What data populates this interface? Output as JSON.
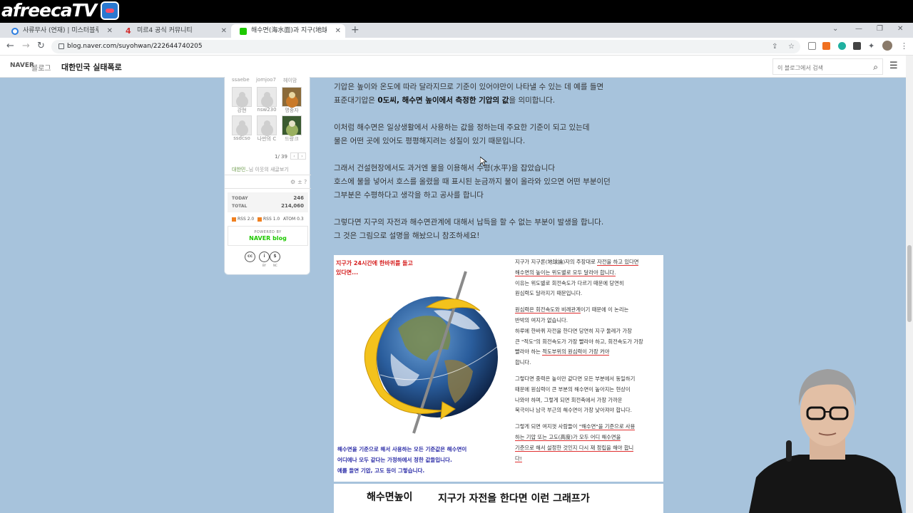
{
  "stream": {
    "logo": "afreecaTV"
  },
  "tabs": [
    {
      "label": "사류무사 (연재) | 미스터블루 - 웹",
      "icon": "chat-icon",
      "color": "#2a7de1"
    },
    {
      "label": "미르4 공식 커뮤니티",
      "icon": "mir4-icon",
      "color": "#d32f2f"
    },
    {
      "label": "해수면(海水面)과 지구(地球)의 기",
      "icon": "naver-blog-icon",
      "color": "#1ec800"
    }
  ],
  "address": {
    "url": "blog.naver.com/suyohwan/222644740205"
  },
  "blog": {
    "naver": "NAVER",
    "blog_label": "블로그",
    "title": "대한민국 실태폭로",
    "search_placeholder": "이 블로그에서 검색"
  },
  "sidebar": {
    "top_names": [
      "ssaebe",
      "jomjoo7",
      "헤이맘"
    ],
    "neighbors": [
      {
        "name": "강현"
      },
      {
        "name": "nsw230"
      },
      {
        "name": "명중자"
      },
      {
        "name": "ssdcso"
      },
      {
        "name": "나만의 C"
      },
      {
        "name": "드랑크"
      }
    ],
    "pager": "1/ 39",
    "neighbors_link": "대한민..",
    "neighbors_rest": "님 이웃의 새글보기",
    "today_label": "TODAY",
    "today_value": "246",
    "total_label": "TOTAL",
    "total_value": "214,060",
    "rss_links": [
      "RSS 2.0",
      "RSS 1.0",
      "ATOM 0.3"
    ],
    "powered_by": "POWERED BY",
    "naver_blog": "NAVER blog",
    "cc_labels": [
      "BY",
      "NC"
    ]
  },
  "article": {
    "p1_l1": "기압은 높이와 온도에 따라 달라지므로 기준이 있어야만이 나타낼 수 있는 데 예를 들면",
    "p1_l2_a": "표준대기압은 ",
    "p1_l2_b": "0도씨, 해수면 높이에서 측정한 기압의 값",
    "p1_l2_c": "을 의미합니다.",
    "p2_l1": "이처럼 해수면은 일상생활에서 사용하는 값을 정하는데 주요한 기준이 되고 있는데",
    "p2_l2": "물은 어떤 곳에 있어도 평평해지려는 성질이 있기 때문입니다.",
    "p3_l1": "그래서 건설현장에서도 과거엔 물을 이용해서 수평(水平)을 잡았습니다",
    "p3_l2": "호스에 물을 넣어서 호스를 올렸을 때 표시된 눈금까지 물이 올라와 있으면 어떤 부분이던",
    "p3_l3": "그부분은 수평하다고 생각을 하고 공사를 합니다",
    "p4_l1": "그렇다면 지구의 자전과 해수면관계에 대해서 납득을 할 수 없는 부분이 발생을 합니다.",
    "p4_l2": "그 것은 그림으로 설명을 해놨으니 참조하세요!"
  },
  "figure": {
    "title_l1": "지구가 24시간에 한바퀴를 돌고",
    "title_l2": "있다면...",
    "bottom_l1": "해수면을 기준으로 해서 사용하는 모든 기준값은 해수면이",
    "bottom_l2": "어디에나 모두 같다는 가정하에서 정한 값들입니다.",
    "bottom_l3": "예를 들면 기압, 고도 등이 그렇습니다.",
    "r1a": "지구가 지구론(地球論)자의 주장대로 ",
    "r1b": "자전을 하고 있다면",
    "r2": "해수면의 높이는 위도별로 모두 달라야 합니다.",
    "r3": "이유는 위도별로 회전속도가 다르기 때문에 당연히",
    "r4": "원심력도 달라지기 때문입니다.",
    "r5a": "원심력은 회전속도와 비례관계",
    "r5b": "이기 때문에 이 논리는",
    "r6": "반박의 여지가 없습니다.",
    "r7": "하루에 한바퀴 자전을 한다면 당연히 지구 둘레가 가장",
    "r8": "큰 \"적도\"의 회전속도가 가장 빨라야 하고, 회전속도가 가장",
    "r9a": "빨라야 하는 ",
    "r9b": "적도부위의 원심력이 가장 커야",
    "r10": "합니다.",
    "r11": "그렇다면 중력은 높이만 같다면 모든 부분에서 동일하기",
    "r12": "때문에 원심력이 큰 부분의 해수면이 높아지는 현상이",
    "r13": "나와야 하며, 그렇게 되면 회전축에서 가장 가까운",
    "r14": "북극이나 남극 부근의 해수면이 가장 낮아져야 합니다.",
    "r15a": "그렇게 되면 여지껏 사람들이 ",
    "r15b": "\"해수면\"을 기준으로 사용",
    "r16a": "하는 기압 또는 고도(高度)가 모두 어디 해수면을",
    "r17a": "기준으로 해서 설정한 것인지 다시 재 정립을 해야 합니",
    "r18": "다!"
  },
  "figure2": {
    "left": "해수면높이",
    "right": "지구가 자전을 한다면 이런 그래프가"
  }
}
